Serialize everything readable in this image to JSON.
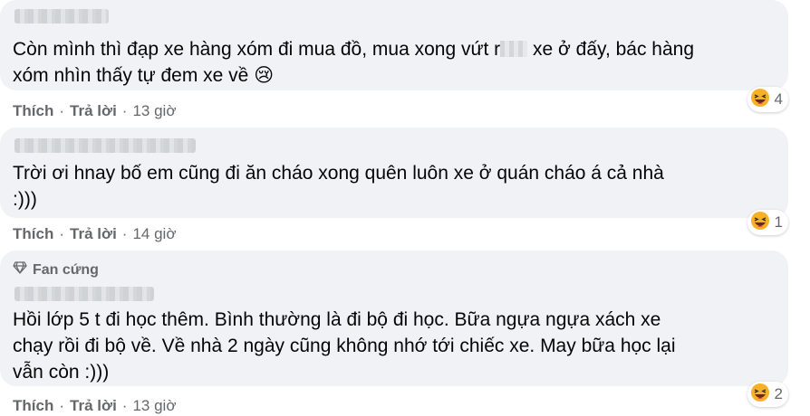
{
  "comments": [
    {
      "text_before_mask": "Còn mình thì đạp xe hàng xóm đi mua đồ, mua xong vứt r",
      "text_after_mask": " xe ở đấy, bác hàng\nxóm nhìn thấy tự đem xe về ",
      "emoji": "😢",
      "like_label": "Thích",
      "reply_label": "Trả lời",
      "time": "13 giờ",
      "reaction_icon": "laughing-emoji-icon",
      "reaction_count": "4"
    },
    {
      "text": "Trời ơi hnay bố em cũng đi ăn cháo xong quên luôn xe ở quán cháo á cả nhà\n:)))",
      "like_label": "Thích",
      "reply_label": "Trả lời",
      "time": "14 giờ",
      "reaction_icon": "laughing-emoji-icon",
      "reaction_count": "1"
    },
    {
      "badge": "Fan cứng",
      "badge_icon": "diamond-icon",
      "text": "Hồi lớp 5 t đi học thêm. Bình thường là đi bộ đi học. Bữa ngựa ngựa xách xe\nchạy rồi đi bộ về. Về nhà 2 ngày cũng không nhớ tới chiếc xe. May bữa học lại\nvẫn còn :)))",
      "like_label": "Thích",
      "reply_label": "Trả lời",
      "time": "13 giờ",
      "reaction_icon": "laughing-emoji-icon",
      "reaction_count": "2"
    }
  ],
  "colors": {
    "bubble": "#f0f2f5",
    "text": "#050505",
    "secondary": "#65676b"
  }
}
